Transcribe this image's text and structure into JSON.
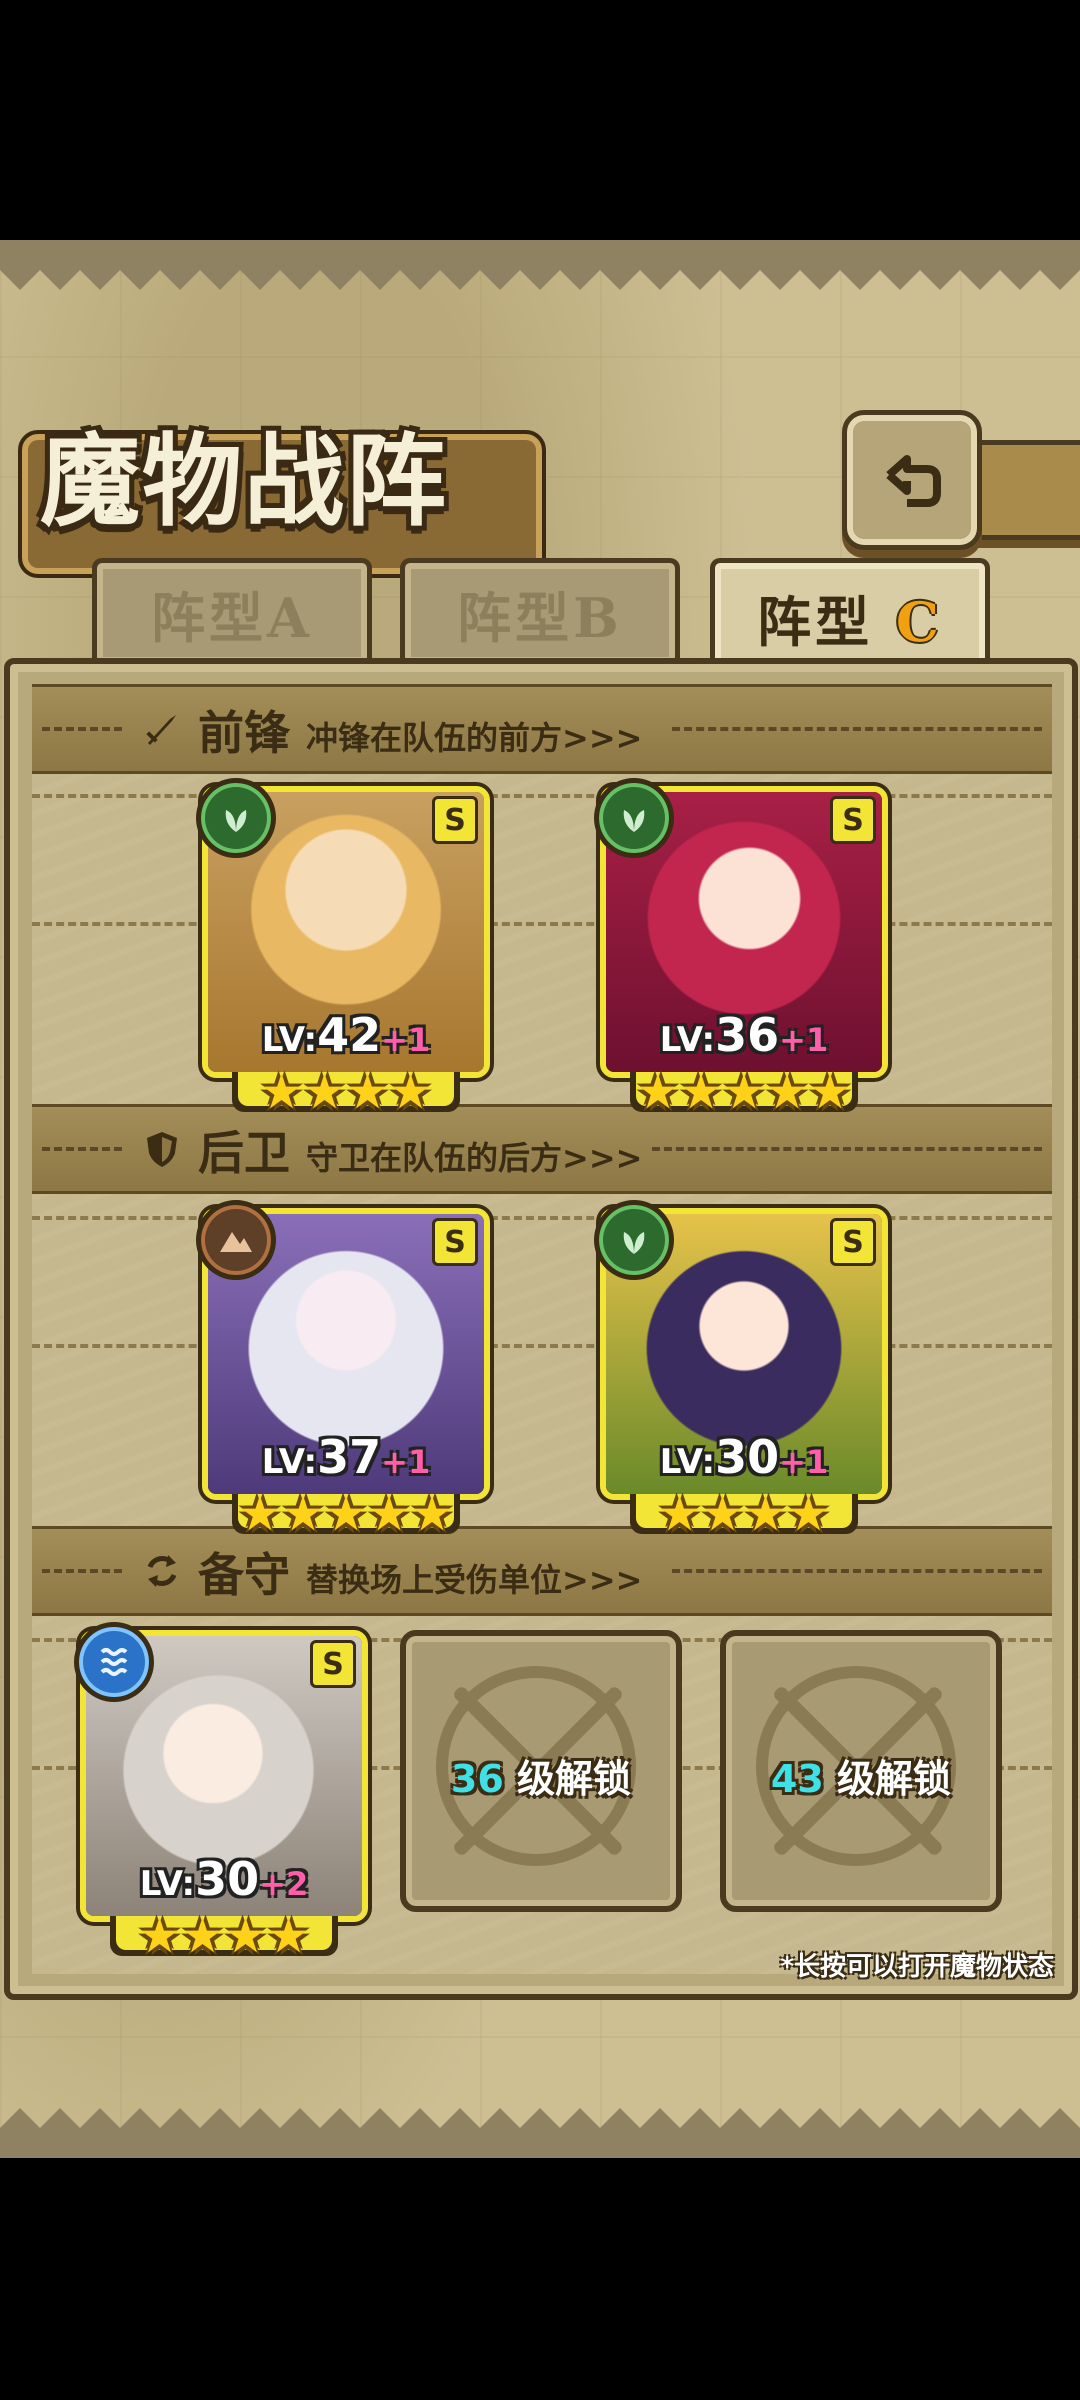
{
  "header": {
    "title": "魔物战阵"
  },
  "tabs": [
    {
      "label": "阵型A",
      "active": false
    },
    {
      "label": "阵型B",
      "active": false
    },
    {
      "label": "阵型",
      "suffix": "C",
      "active": true
    }
  ],
  "sections": {
    "front": {
      "title": "前锋",
      "desc": "冲锋在队伍的前方>>>"
    },
    "rear": {
      "title": "后卫",
      "desc": "守卫在队伍的后方>>>"
    },
    "reserve": {
      "title": "备守",
      "desc": "替换场上受伤单位>>>"
    }
  },
  "units": {
    "front1": {
      "rank": "S",
      "element": "nature",
      "lv_prefix": "LV:",
      "lv": "42",
      "plus": "+1",
      "stars": "★★★★"
    },
    "front2": {
      "rank": "S",
      "element": "nature",
      "lv_prefix": "LV:",
      "lv": "36",
      "plus": "+1",
      "stars": "★★★★★"
    },
    "rear1": {
      "rank": "S",
      "element": "earth",
      "lv_prefix": "LV:",
      "lv": "37",
      "plus": "+1",
      "stars": "★★★★★"
    },
    "rear2": {
      "rank": "S",
      "element": "nature",
      "lv_prefix": "LV:",
      "lv": "30",
      "plus": "+1",
      "stars": "★★★★"
    },
    "reserve1": {
      "rank": "S",
      "element": "water",
      "lv_prefix": "LV:",
      "lv": "30",
      "plus": "+2",
      "stars": "★★★★"
    }
  },
  "locked_slots": [
    {
      "level": "36",
      "label": "级解锁"
    },
    {
      "level": "43",
      "label": "级解锁"
    }
  ],
  "hint": "*长按可以打开魔物状态",
  "colors": {
    "frame": "#f2e535",
    "active_tab_letter": "#f0a010",
    "unlock_level": "#3fe0e6"
  }
}
